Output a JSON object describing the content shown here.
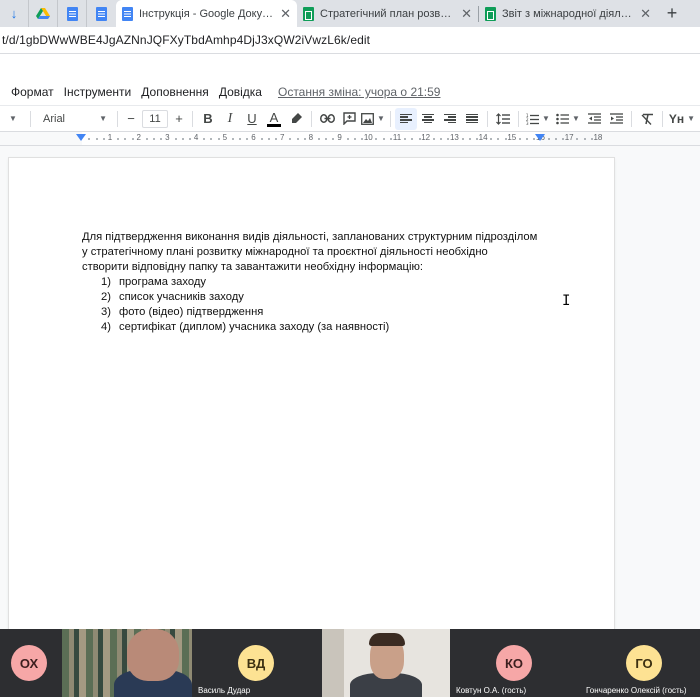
{
  "tabs": [
    {
      "type": "mini",
      "icon": "download-arrow-icon"
    },
    {
      "type": "mini",
      "icon": "google-drive-icon"
    },
    {
      "type": "mini",
      "icon": "google-docs-icon"
    },
    {
      "type": "mini",
      "icon": "google-docs-icon"
    },
    {
      "type": "full",
      "icon": "google-docs-icon",
      "title": "Інструкція - Google Документи",
      "active": true
    },
    {
      "type": "full",
      "icon": "google-sheets-icon",
      "title": "Стратегічний план розвитку між",
      "active": false
    },
    {
      "type": "full",
      "icon": "google-sheets-icon",
      "title": "Звіт з міжнародної діяльності - G",
      "active": false
    }
  ],
  "address": {
    "url": "t/d/1gbDWwWBE4JgAZNnJQFXyTbdAmhp4DjJ3xQW2iVwzL6k/edit"
  },
  "menu": {
    "items": [
      "Формат",
      "Інструменти",
      "Доповнення",
      "Довідка"
    ],
    "last_edit": "Остання зміна: учора о 21:59"
  },
  "toolbar": {
    "font": "Arial",
    "font_size": "11",
    "minus": "−",
    "plus": "+",
    "bold": "B",
    "italic": "I",
    "underline": "U",
    "text_color": "A",
    "text_color_value": "#000000",
    "input_tools": "Yн"
  },
  "ruler": {
    "numbers": [
      "1",
      "2",
      "3",
      "4",
      "5",
      "6",
      "7",
      "8",
      "9",
      "10",
      "11",
      "12",
      "13",
      "14",
      "15",
      "16",
      "17",
      "18"
    ]
  },
  "document": {
    "paragraph_lines": [
      "Для підтвердження виконання видів діяльності, запланованих структурним підрозділом",
      "у стратегічному плані розвитку міжнародної та проєктної діяльності необхідно",
      "створити відповідну папку та завантажити необхідну  інформацію:"
    ],
    "list": [
      {
        "num": "1)",
        "text": "програма заходу"
      },
      {
        "num": "2)",
        "text": "список учасників заходу"
      },
      {
        "num": "3)",
        "text": "фото (відео) підтвердження"
      },
      {
        "num": "4)",
        "text": "сертифікат (диплом) учасника заходу (за наявності)"
      }
    ],
    "cursor": "I"
  },
  "participants": [
    {
      "initials": "ОХ",
      "name": "",
      "kind": "avatar",
      "color": "#f6a7a7"
    },
    {
      "initials": "",
      "name": "",
      "kind": "video"
    },
    {
      "initials": "ВД",
      "name": "Василь Дудар",
      "kind": "avatar",
      "color": "#fde293"
    },
    {
      "initials": "",
      "name": "",
      "kind": "video"
    },
    {
      "initials": "КО",
      "name": "Ковтун О.А. (гость)",
      "kind": "avatar",
      "color": "#f6a7a7"
    },
    {
      "initials": "ГО",
      "name": "Гончаренко Олексій (гость)",
      "kind": "avatar",
      "color": "#fde293"
    }
  ]
}
